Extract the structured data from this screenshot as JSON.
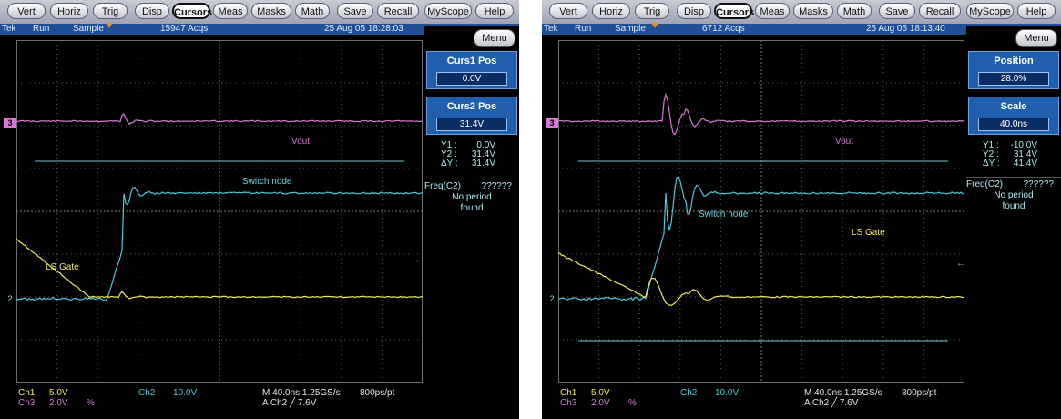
{
  "menu": {
    "items": [
      "Vert",
      "Horiz",
      "Trig",
      "Disp",
      "Cursors",
      "Meas",
      "Masks",
      "Math",
      "Save",
      "Recall",
      "MyScope",
      "Help"
    ],
    "active": "Cursors"
  },
  "colors": {
    "ch1": "#f0ea5a",
    "ch2": "#4ec8dc",
    "ch3": "#d77ad7",
    "status_bar": "#1f4f96",
    "panel": "#1f5fae"
  },
  "left": {
    "status": {
      "brand": "Tek",
      "run": "Run",
      "mode": "Sample",
      "acqs": "15947 Acqs",
      "datetime": "25 Aug 05 18:28:03"
    },
    "menu_label": "Menu",
    "panel1": {
      "title": "Curs1 Pos",
      "value": "0.0V"
    },
    "panel2": {
      "title": "Curs2 Pos",
      "value": "31.4V"
    },
    "readouts": {
      "y1_label": "Y1 :",
      "y1_value": "0.0V",
      "y2_label": "Y2 :",
      "y2_value": "31.4V",
      "dy_label": "ΔY :",
      "dy_value": "31.4V"
    },
    "freq": {
      "label": "Freq(C2)",
      "value": "??????",
      "msg1": "No period",
      "msg2": "found"
    },
    "traces": {
      "vout": "Vout",
      "switch": "Switch node",
      "gate": "LS Gate"
    },
    "markers": {
      "ch3": "3",
      "ch2": "2"
    },
    "bottom": {
      "ch1_label": "Ch1",
      "ch1_scale": "5.0V",
      "ch2_label": "Ch2",
      "ch2_scale": "10.0V",
      "ch3_label": "Ch3",
      "ch3_scale": "2.0V",
      "ch3_suffix": "%",
      "timebase": "M 40.0ns 1.25GS/s",
      "rate": "800ps/pt",
      "trigger": "A  Ch2  ╱  7.6V"
    }
  },
  "right": {
    "status": {
      "brand": "Tek",
      "run": "Run",
      "mode": "Sample",
      "acqs": "6712 Acqs",
      "datetime": "25 Aug 05 18:13:40"
    },
    "menu_label": "Menu",
    "panel1": {
      "title": "Position",
      "value": "28.0%"
    },
    "panel2": {
      "title": "Scale",
      "value": "40.0ns"
    },
    "readouts": {
      "y1_label": "Y1 :",
      "y1_value": "-10.0V",
      "y2_label": "Y2 :",
      "y2_value": "31.4V",
      "dy_label": "ΔY :",
      "dy_value": "41.4V"
    },
    "freq": {
      "label": "Freq(C2)",
      "value": "??????",
      "msg1": "No period",
      "msg2": "found"
    },
    "traces": {
      "vout": "Vout",
      "switch": "Switch node",
      "gate": "LS Gate"
    },
    "markers": {
      "ch3": "3",
      "ch2": "2"
    },
    "bottom": {
      "ch1_label": "Ch1",
      "ch1_scale": "5.0V",
      "ch2_label": "Ch2",
      "ch2_scale": "10.0V",
      "ch3_label": "Ch3",
      "ch3_scale": "2.0V",
      "ch3_suffix": "%",
      "timebase": "M 40.0ns 1.25GS/s",
      "rate": "800ps/pt",
      "trigger": "A  Ch2  ╱  7.6V"
    }
  }
}
